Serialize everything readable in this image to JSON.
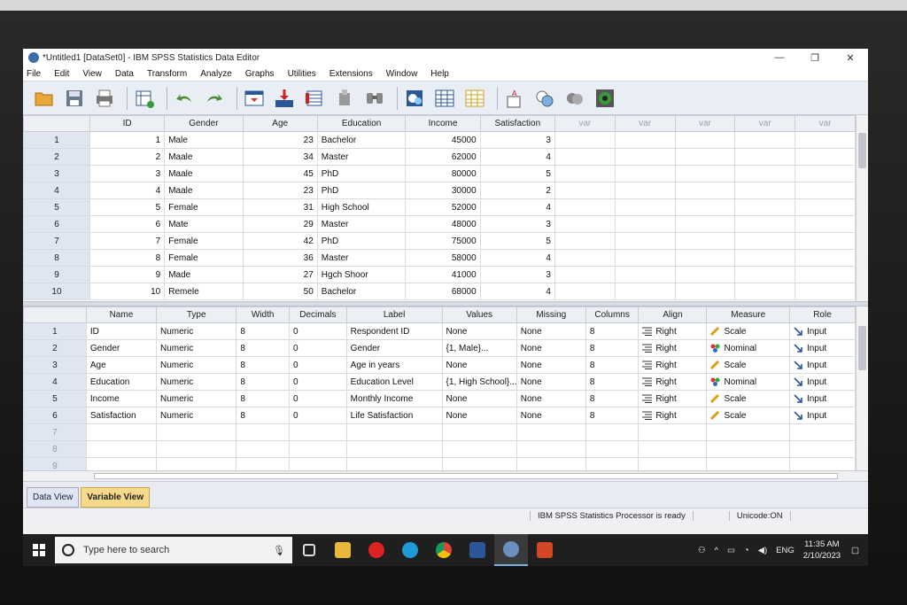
{
  "window": {
    "title": "*Untitled1 [DataSet0] - IBM SPSS Statistics Data Editor",
    "minimize": "—",
    "maximize": "❐",
    "close": "✕"
  },
  "menu": [
    "File",
    "Edit",
    "View",
    "Data",
    "Transform",
    "Analyze",
    "Graphs",
    "Utilities",
    "Extensions",
    "Window",
    "Help"
  ],
  "toolbar_icons": [
    "open-icon",
    "save-icon",
    "print-icon",
    "dialog-recall-icon",
    "undo-icon",
    "redo-icon",
    "goto-case-icon",
    "goto-variable-icon",
    "variables-icon",
    "run-descriptives-icon",
    "find-icon",
    "insert-cases-icon",
    "insert-variable-icon",
    "split-file-icon",
    "weight-cases-icon",
    "select-cases-icon",
    "value-labels-icon",
    "use-sets-icon",
    "spelling-icon"
  ],
  "data_view": {
    "columns": [
      "ID",
      "Gender",
      "Age",
      "Education",
      "Income",
      "Satisfaction",
      "var",
      "var",
      "var",
      "var",
      "var"
    ],
    "rows": [
      [
        "1",
        "1",
        "Male",
        "23",
        "Bachelor",
        "45000",
        "3"
      ],
      [
        "2",
        "2",
        "Maale",
        "34",
        "Master",
        "62000",
        "4"
      ],
      [
        "3",
        "3",
        "Maale",
        "45",
        "PhD",
        "80000",
        "5"
      ],
      [
        "4",
        "4",
        "Maale",
        "23",
        "PhD",
        "30000",
        "2"
      ],
      [
        "5",
        "5",
        "Female",
        "31",
        "High School",
        "52000",
        "4"
      ],
      [
        "6",
        "6",
        "Mate",
        "29",
        "Master",
        "48000",
        "3"
      ],
      [
        "7",
        "7",
        "Female",
        "42",
        "PhD",
        "75000",
        "5"
      ],
      [
        "8",
        "8",
        "Female",
        "36",
        "Master",
        "58000",
        "4"
      ],
      [
        "9",
        "9",
        "Made",
        "27",
        "Hgch Shoor",
        "41000",
        "3"
      ],
      [
        "10",
        "10",
        "Remele",
        "50",
        "Bachelor",
        "68000",
        "4"
      ]
    ]
  },
  "variable_view": {
    "columns": [
      "Name",
      "Type",
      "Width",
      "Decimals",
      "Label",
      "Values",
      "Missing",
      "Columns",
      "Align",
      "Measure",
      "Role"
    ],
    "rows": [
      {
        "n": "1",
        "name": "ID",
        "type": "Numeric",
        "width": "8",
        "dec": "0",
        "label": "Respondent ID",
        "values": "None",
        "missing": "None",
        "columns": "8",
        "align": "Right",
        "measure": "Scale",
        "role": "Input"
      },
      {
        "n": "2",
        "name": "Gender",
        "type": "Numeric",
        "width": "8",
        "dec": "0",
        "label": "Gender",
        "values": "{1, Male}...",
        "missing": "None",
        "columns": "8",
        "align": "Right",
        "measure": "Nominal",
        "role": "Input"
      },
      {
        "n": "3",
        "name": "Age",
        "type": "Numeric",
        "width": "8",
        "dec": "0",
        "label": "Age in years",
        "values": "None",
        "missing": "None",
        "columns": "8",
        "align": "Right",
        "measure": "Scale",
        "role": "Input"
      },
      {
        "n": "4",
        "name": "Education",
        "type": "Numeric",
        "width": "8",
        "dec": "0",
        "label": "Education Level",
        "values": "{1, High School}...",
        "missing": "None",
        "columns": "8",
        "align": "Right",
        "measure": "Nominal",
        "role": "Input"
      },
      {
        "n": "5",
        "name": "Income",
        "type": "Numeric",
        "width": "8",
        "dec": "0",
        "label": "Monthly Income",
        "values": "None",
        "missing": "None",
        "columns": "8",
        "align": "Right",
        "measure": "Scale",
        "role": "Input"
      },
      {
        "n": "6",
        "name": "Satisfaction",
        "type": "Numeric",
        "width": "8",
        "dec": "0",
        "label": "Life Satisfaction",
        "values": "None",
        "missing": "None",
        "columns": "8",
        "align": "Right",
        "measure": "Scale",
        "role": "Input"
      }
    ],
    "empty_rows": [
      "7",
      "8",
      "9"
    ]
  },
  "tabs": {
    "data_view": "Data View",
    "variable_view": "Variable View"
  },
  "status": {
    "processor": "IBM SPSS Statistics Processor is ready",
    "unicode": "Unicode:ON"
  },
  "taskbar": {
    "search_placeholder": "Type here to search",
    "apps": [
      "task-view-icon",
      "file-explorer-icon",
      "opera-icon",
      "edge-icon",
      "chrome-icon",
      "word-icon",
      "spss-icon",
      "powerpoint-icon"
    ],
    "lang": "ENG",
    "time": "11:35 AM",
    "date": "2/10/2023"
  },
  "colors": {
    "accent_tab": "#f7d98b",
    "row_header": "#dfe6f1",
    "taskbar": "#1f1f1f"
  }
}
